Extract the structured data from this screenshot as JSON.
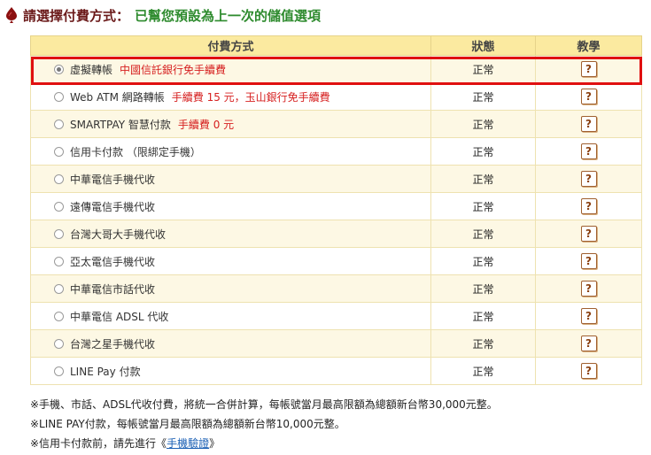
{
  "header": {
    "title": "請選擇付費方式：",
    "subtitle": "已幫您預設為上一次的儲值選項"
  },
  "table": {
    "headers": [
      "付費方式",
      "狀態",
      "教學"
    ],
    "help_glyph": "?",
    "rows": [
      {
        "name": "虛擬轉帳",
        "note": "中國信託銀行免手續費",
        "status": "正常",
        "selected": true
      },
      {
        "name": "Web ATM 網路轉帳",
        "note": "手續費 15 元，玉山銀行免手續費",
        "status": "正常",
        "selected": false
      },
      {
        "name": "SMARTPAY 智慧付款",
        "note": "手續費 0 元",
        "status": "正常",
        "selected": false
      },
      {
        "name": "信用卡付款 （限綁定手機）",
        "note": "",
        "status": "正常",
        "selected": false
      },
      {
        "name": "中華電信手機代收",
        "note": "",
        "status": "正常",
        "selected": false
      },
      {
        "name": "遠傳電信手機代收",
        "note": "",
        "status": "正常",
        "selected": false
      },
      {
        "name": "台灣大哥大手機代收",
        "note": "",
        "status": "正常",
        "selected": false
      },
      {
        "name": "亞太電信手機代收",
        "note": "",
        "status": "正常",
        "selected": false
      },
      {
        "name": "中華電信市話代收",
        "note": "",
        "status": "正常",
        "selected": false
      },
      {
        "name": "中華電信 ADSL 代收",
        "note": "",
        "status": "正常",
        "selected": false
      },
      {
        "name": "台灣之星手機代收",
        "note": "",
        "status": "正常",
        "selected": false
      },
      {
        "name": "LINE Pay 付款",
        "note": "",
        "status": "正常",
        "selected": false
      }
    ]
  },
  "notes": {
    "line1": "※手機、市話、ADSL代收付費，將統一合併計算，每帳號當月最高限額為總額新台幣30,000元整。",
    "line2": "※LINE PAY付款，每帳號當月最高限額為總額新台幣10,000元整。",
    "line3_prefix": "※信用卡付款前，請先進行《",
    "line3_link": "手機驗證",
    "line3_suffix": "》"
  },
  "colors": {
    "title": "#6b1a1a",
    "subtitle": "#2e8b2e",
    "header_bg": "#fbeaa0",
    "note_red": "#d62020",
    "highlight": "#e01010"
  }
}
